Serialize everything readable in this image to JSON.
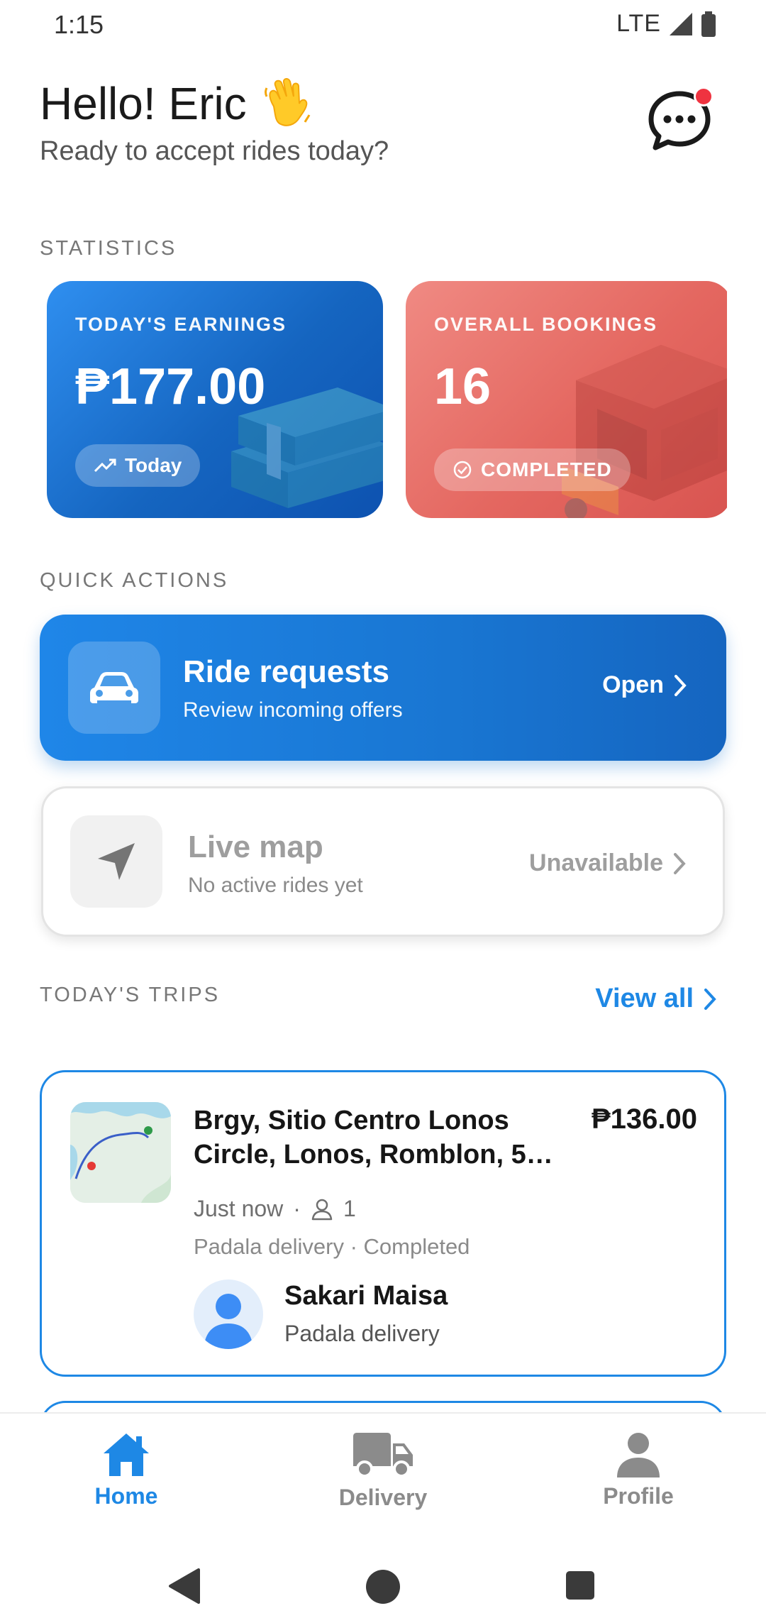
{
  "status_bar": {
    "time": "1:15",
    "network": "LTE"
  },
  "header": {
    "greeting": "Hello! Eric",
    "subtitle": "Ready to accept rides today?"
  },
  "statistics": {
    "section_label": "STATISTICS",
    "earnings": {
      "label": "TODAY'S EARNINGS",
      "value": "₱177.00",
      "pill": "Today"
    },
    "bookings": {
      "label": "OVERALL BOOKINGS",
      "value": "16",
      "pill": "COMPLETED"
    }
  },
  "quick_actions": {
    "section_label": "QUICK ACTIONS",
    "ride_requests": {
      "title": "Ride requests",
      "subtitle": "Review incoming offers",
      "action": "Open"
    },
    "live_map": {
      "title": "Live map",
      "subtitle": "No active rides yet",
      "action": "Unavailable"
    }
  },
  "trips": {
    "section_label": "TODAY'S TRIPS",
    "view_all": "View all",
    "items": [
      {
        "address": "Brgy, Sitio Centro Lonos Circle, Lonos, Romblon, 5…",
        "price": "₱136.00",
        "time": "Just now",
        "passengers": "1",
        "type_status": "Padala delivery · Completed",
        "customer_name": "Sakari Maisa",
        "customer_sub": "Padala delivery"
      }
    ]
  },
  "bottom_nav": {
    "items": [
      {
        "label": "Home",
        "icon": "home-icon",
        "active": true
      },
      {
        "label": "Delivery",
        "icon": "truck-icon",
        "active": false
      },
      {
        "label": "Profile",
        "icon": "person-icon",
        "active": false
      }
    ]
  },
  "colors": {
    "accent": "#1e88e5",
    "earnings_card": "#1565c0",
    "bookings_card": "#e46760",
    "notification_dot": "#ef3340"
  }
}
